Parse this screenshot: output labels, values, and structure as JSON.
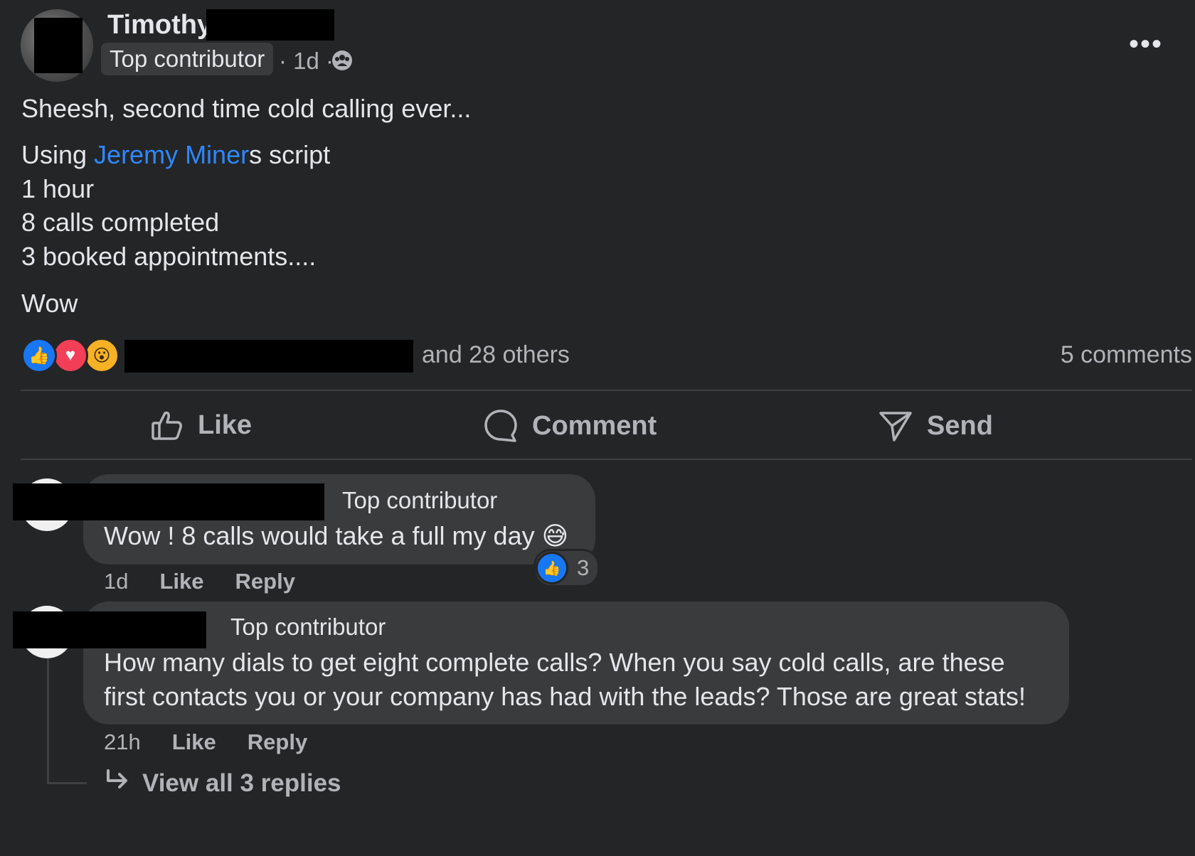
{
  "post": {
    "author_first": "Timothy",
    "badge": "Top contributor",
    "meta_time": "· 1d ·",
    "lines": [
      "Sheesh, second time cold calling ever...",
      "1 hour",
      "8 calls completed",
      "3 booked appointments....",
      "Wow"
    ],
    "script_line": {
      "prefix": "Using ",
      "mention": "Jeremy Miner",
      "suffix": "s script"
    }
  },
  "reactions": {
    "others_text": "and 28 others",
    "comments_count": "5 comments"
  },
  "actions": {
    "like": "Like",
    "comment": "Comment",
    "send": "Send"
  },
  "comments": [
    {
      "badge": "Top contributor",
      "text": "Wow ! 8 calls would take a full my day 😅",
      "time": "1d",
      "like": "Like",
      "reply": "Reply",
      "like_count": "3"
    },
    {
      "badge": "Top contributor",
      "text_line1": "How many dials to get eight complete calls? When you say cold calls, are these",
      "text_line2": "first contacts you or your company has had with the leads? Those are great stats!",
      "time": "21h",
      "like": "Like",
      "reply": "Reply",
      "view_replies": "View all 3 replies"
    }
  ]
}
